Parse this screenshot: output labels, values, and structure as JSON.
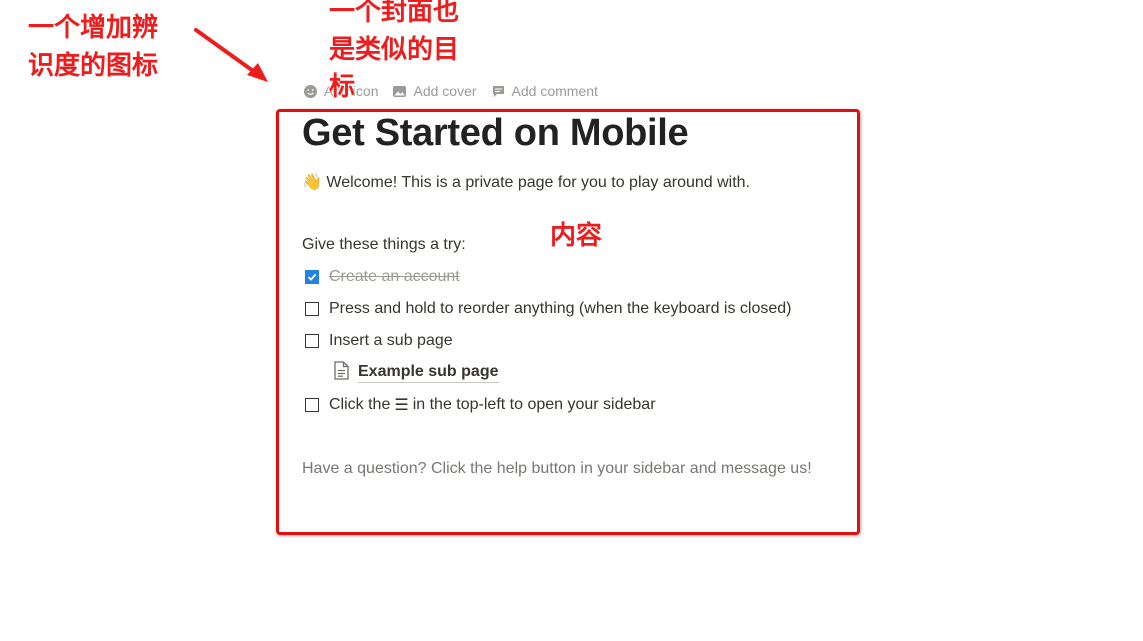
{
  "annotations": {
    "icon_note": "一个增加辨识度的图标",
    "cover_note": "一个封面也是类似的目标",
    "content_note": "内容",
    "highlight_color": "#e01010"
  },
  "controls": {
    "add_icon": "Add icon",
    "add_cover": "Add cover",
    "add_comment": "Add comment"
  },
  "page": {
    "title": "Get Started on Mobile",
    "welcome_emoji": "👋",
    "welcome_text": "Welcome! This is a private page for you to play around with.",
    "try_heading": "Give these things a try:",
    "todos": [
      {
        "label": "Create an account",
        "checked": true
      },
      {
        "label": "Press and hold to reorder anything (when the keyboard is closed)",
        "checked": false
      },
      {
        "label": "Insert a sub page",
        "checked": false
      }
    ],
    "subpage": "Example sub page",
    "last_todo": {
      "before": "Click the",
      "glyph": "☰",
      "after": "in the top-left to open your sidebar",
      "checked": false
    },
    "help_text": "Have a question? Click the help button in your sidebar and message us!"
  },
  "colors": {
    "accent": "#2383e2",
    "text": "#37352f",
    "muted": "#9b9a97",
    "annotation": "#ee1c1c"
  }
}
